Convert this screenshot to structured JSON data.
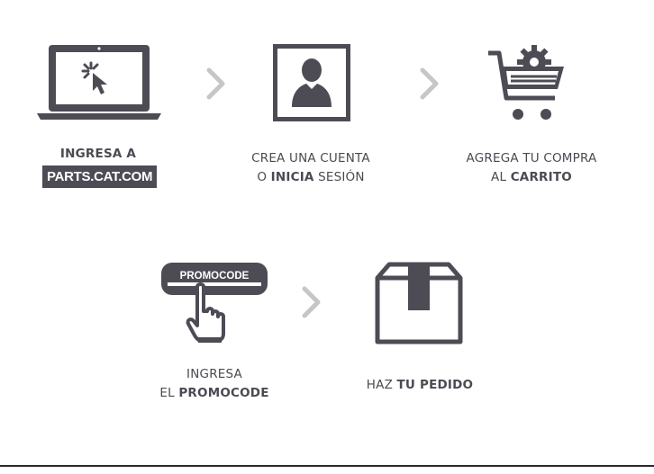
{
  "steps": [
    {
      "line1": "INGRESA A",
      "badge": "PARTS.CAT.COM",
      "icon": "laptop-cursor-icon"
    },
    {
      "line1": "CREA UNA CUENTA",
      "line2_pre": "O ",
      "line2_bold": "INICIA",
      "line2_post": " SESIÓN",
      "icon": "user-profile-icon"
    },
    {
      "line1": "AGREGA TU COMPRA",
      "line2_pre": "AL ",
      "line2_bold": "CARRITO",
      "icon": "shopping-cart-gear-icon"
    },
    {
      "line1": "INGRESA",
      "line2_pre": "EL ",
      "line2_bold": "PROMOCODE",
      "icon": "promocode-hand-icon",
      "button_text": "PROMOCODE"
    },
    {
      "line1_pre": "HAZ ",
      "line1_bold": "TU PEDIDO",
      "icon": "package-box-icon"
    }
  ],
  "colors": {
    "icon": "#4d4c55",
    "arrow": "#c6c6c6",
    "text": "#4a4a52"
  }
}
